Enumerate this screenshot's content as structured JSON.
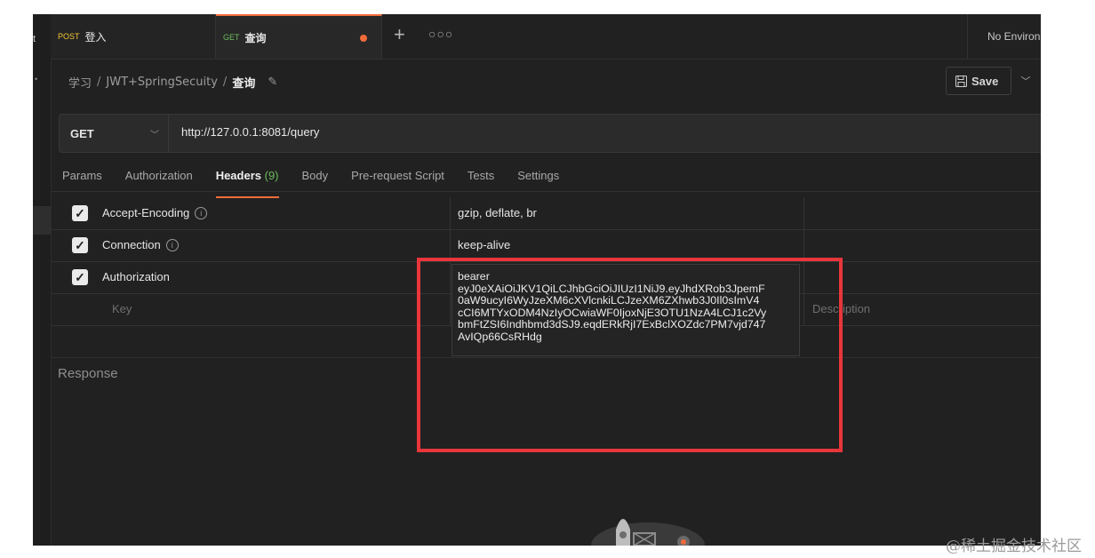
{
  "tabs": [
    {
      "method": "POST",
      "name": "登入"
    },
    {
      "method": "GET",
      "name": "查询",
      "unsaved": true
    }
  ],
  "more_tabs_glyph": "○○○",
  "environment": {
    "label": "No Environ"
  },
  "breadcrumb": {
    "workspace": "学习",
    "collection": "JWT+SpringSecuity",
    "current": "查询"
  },
  "save_button": {
    "label": "Save"
  },
  "request": {
    "method": "GET",
    "url": "http://127.0.0.1:8081/query"
  },
  "request_tabs": [
    {
      "label": "Params"
    },
    {
      "label": "Authorization"
    },
    {
      "label": "Headers",
      "count": "(9)",
      "active": true
    },
    {
      "label": "Body"
    },
    {
      "label": "Pre-request Script"
    },
    {
      "label": "Tests"
    },
    {
      "label": "Settings"
    }
  ],
  "headers": [
    {
      "key": "Accept-Encoding",
      "value": "gzip, deflate, br",
      "checked": true,
      "info": true
    },
    {
      "key": "Connection",
      "value": "keep-alive",
      "checked": true,
      "info": true
    },
    {
      "key": "Authorization",
      "value": "",
      "checked": true,
      "info": false
    }
  ],
  "placeholders": {
    "key": "Key",
    "description": "Description"
  },
  "token_lines": [
    "bearer",
    "eyJ0eXAiOiJKV1QiLCJhbGciOiJIUzI1NiJ9.eyJhdXRob3JpemF",
    "0aW9ucyI6WyJzeXM6cXVlcnkiLCJzeXM6ZXhwb3J0Il0sImV4",
    "cCI6MTYxODM4NzIyOCwiaWF0IjoxNjE3OTU1NzA4LCJ1c2Vy",
    "bmFtZSI6Indhbmd3dSJ9.eqdERkRjI7ExBclXOZdc7PM7vjd747",
    "AvIQp66CsRHdg"
  ],
  "response": {
    "title": "Response"
  },
  "watermark": "@稀土掘金技术社区",
  "colors": {
    "accent": "#f26b3a",
    "get": "#6bbd5b",
    "post": "#f3c431",
    "annotation": "#e8363b"
  }
}
